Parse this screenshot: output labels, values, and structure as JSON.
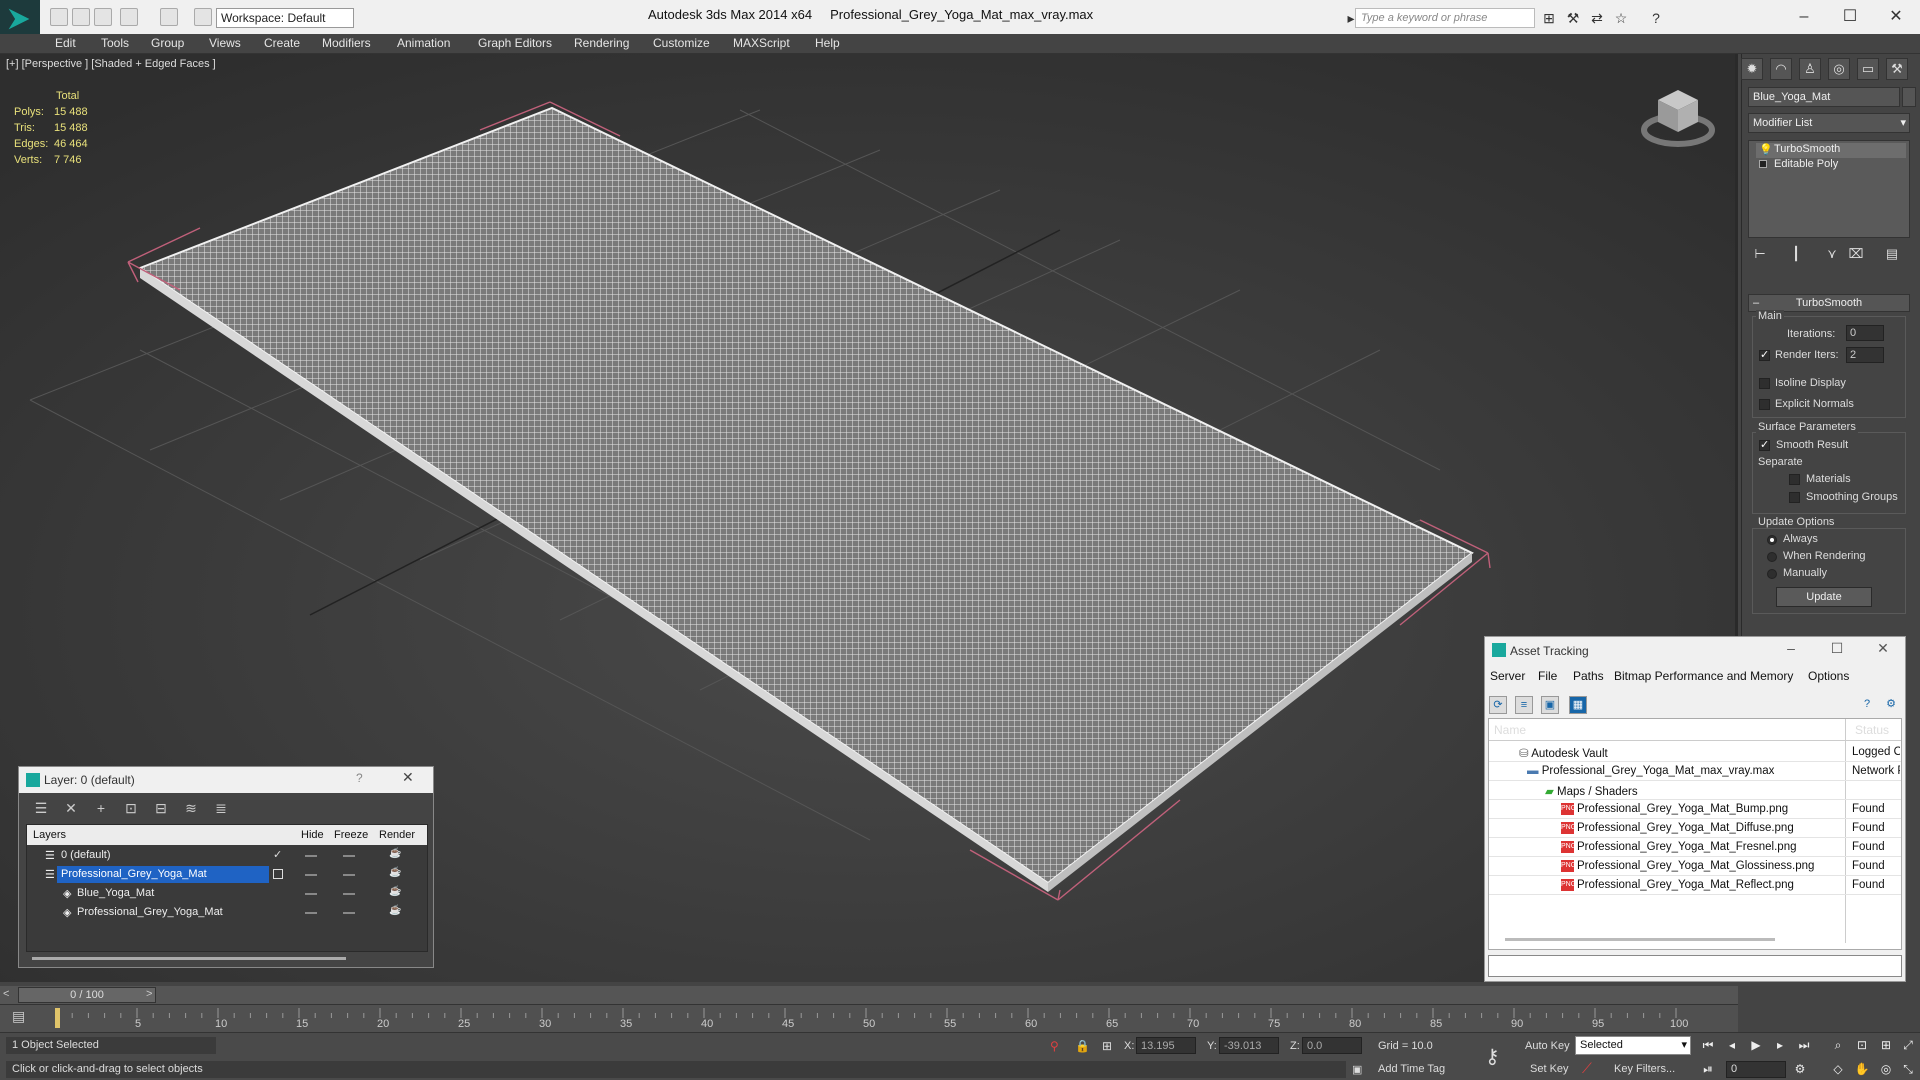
{
  "titlebar": {
    "app_title": "Autodesk 3ds Max  2014 x64",
    "file_name": "Professional_Grey_Yoga_Mat_max_vray.max",
    "workspace": "Workspace: Default",
    "search_placeholder": "Type a keyword or phrase"
  },
  "menu": [
    "Edit",
    "Tools",
    "Group",
    "Views",
    "Create",
    "Modifiers",
    "Animation",
    "Graph Editors",
    "Rendering",
    "Customize",
    "MAXScript",
    "Help"
  ],
  "viewport": {
    "label": "[+] [Perspective ] [Shaded + Edged Faces ]",
    "stats_header": "Total",
    "stats": [
      {
        "k": "Polys:",
        "v": "15 488"
      },
      {
        "k": "Tris:",
        "v": "15 488"
      },
      {
        "k": "Edges:",
        "v": "46 464"
      },
      {
        "k": "Verts:",
        "v": "7 746"
      }
    ]
  },
  "command_panel": {
    "object_name": "Blue_Yoga_Mat",
    "modifier_list": "Modifier List",
    "stack": [
      "TurboSmooth",
      "Editable Poly"
    ],
    "rollout_title": "TurboSmooth",
    "main_label": "Main",
    "iterations_label": "Iterations:",
    "iterations_value": "0",
    "render_iters_label": "Render Iters:",
    "render_iters_value": "2",
    "isoline_label": "Isoline Display",
    "explicit_label": "Explicit Normals",
    "surface_params_label": "Surface Parameters",
    "smooth_result_label": "Smooth Result",
    "separate_label": "Separate",
    "materials_label": "Materials",
    "smoothing_groups_label": "Smoothing Groups",
    "update_options_label": "Update Options",
    "always_label": "Always",
    "when_rendering_label": "When Rendering",
    "manually_label": "Manually",
    "update_button": "Update"
  },
  "asset_tracking": {
    "title": "Asset Tracking",
    "menu": [
      "Server",
      "File",
      "Paths",
      "Bitmap Performance and Memory",
      "Options"
    ],
    "col_name": "Name",
    "col_status": "Status",
    "rows": [
      {
        "name": "Autodesk Vault",
        "status": "Logged Out"
      },
      {
        "name": "Professional_Grey_Yoga_Mat_max_vray.max",
        "status": "Network Path"
      },
      {
        "name": "Maps / Shaders",
        "status": ""
      },
      {
        "name": "Professional_Grey_Yoga_Mat_Bump.png",
        "status": "Found"
      },
      {
        "name": "Professional_Grey_Yoga_Mat_Diffuse.png",
        "status": "Found"
      },
      {
        "name": "Professional_Grey_Yoga_Mat_Fresnel.png",
        "status": "Found"
      },
      {
        "name": "Professional_Grey_Yoga_Mat_Glossiness.png",
        "status": "Found"
      },
      {
        "name": "Professional_Grey_Yoga_Mat_Reflect.png",
        "status": "Found"
      }
    ]
  },
  "layer_window": {
    "title": "Layer: 0 (default)",
    "col_layers": "Layers",
    "col_hide": "Hide",
    "col_freeze": "Freeze",
    "col_render": "Render",
    "rows": [
      "0 (default)",
      "Professional_Grey_Yoga_Mat",
      "Blue_Yoga_Mat",
      "Professional_Grey_Yoga_Mat"
    ]
  },
  "timeline": {
    "frame_display": "0 / 100",
    "ticks": [
      "5",
      "10",
      "15",
      "20",
      "25",
      "30",
      "35",
      "40",
      "45",
      "50",
      "55",
      "60",
      "65",
      "70",
      "75",
      "80",
      "85",
      "90",
      "95",
      "100"
    ]
  },
  "status": {
    "selection": "1 Object Selected",
    "prompt": "Click or click-and-drag to select objects",
    "x_label": "X:",
    "x_value": "13.195",
    "y_label": "Y:",
    "y_value": "-39.013",
    "z_label": "Z:",
    "z_value": "0.0",
    "grid": "Grid = 10.0",
    "add_time_tag": "Add Time Tag",
    "auto_key": "Auto Key",
    "set_key": "Set Key",
    "selected_dropdown": "Selected",
    "key_filters": "Key Filters...",
    "current_frame": "0"
  },
  "colors": {
    "wire": "#e8e8e8",
    "selection_bracket": "#c0607a",
    "grid_line": "#555555",
    "stats_text": "#e8e07a",
    "layer_select": "#1f63c4"
  }
}
